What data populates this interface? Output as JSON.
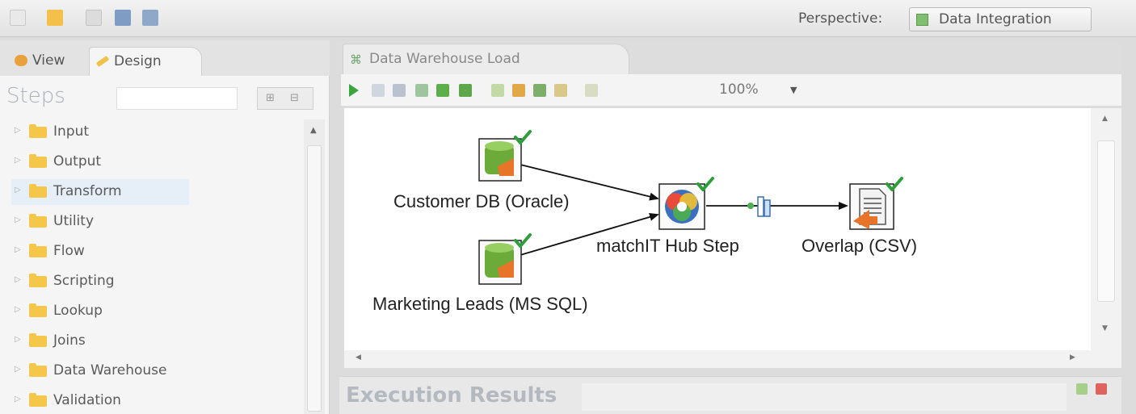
{
  "toolbar": {
    "icons": [
      "new-file-icon",
      "open-folder-icon",
      "explore-icon",
      "save-icon",
      "save-as-icon"
    ],
    "perspective_label": "Perspective:",
    "perspective_value": "Data Integration"
  },
  "left_panel": {
    "tabs": {
      "view": "View",
      "design": "Design"
    },
    "steps_title": "Steps",
    "tree": [
      {
        "label": "Input",
        "selected": false
      },
      {
        "label": "Output",
        "selected": false
      },
      {
        "label": "Transform",
        "selected": true
      },
      {
        "label": "Utility",
        "selected": false
      },
      {
        "label": "Flow",
        "selected": false
      },
      {
        "label": "Scripting",
        "selected": false
      },
      {
        "label": "Lookup",
        "selected": false
      },
      {
        "label": "Joins",
        "selected": false
      },
      {
        "label": "Data Warehouse",
        "selected": false
      },
      {
        "label": "Validation",
        "selected": false
      }
    ]
  },
  "editor": {
    "tab_label": "Data Warehouse Load",
    "zoom": "100%",
    "nodes": {
      "customer_db": "Customer DB (Oracle)",
      "marketing_leads": "Marketing Leads (MS SQL)",
      "matchit": "matchIT Hub Step",
      "overlap": "Overlap (CSV)"
    }
  },
  "execution_results": {
    "title": "Execution Results"
  },
  "colors": {
    "canvas_bg": "#ffffff",
    "check_green": "#2e9e3a",
    "db_green": "#6cab3a",
    "folder_yellow": "#f4c64a"
  }
}
